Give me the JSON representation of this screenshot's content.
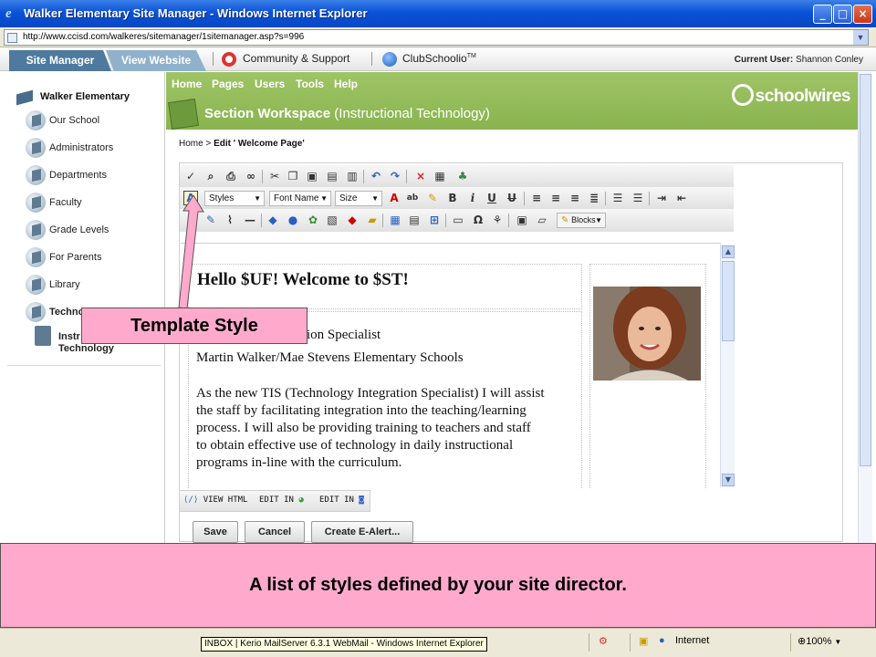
{
  "window": {
    "title": "Walker Elementary Site Manager - Windows Internet Explorer",
    "url": "http://www.ccisd.com/walkeres/sitemanager/1sitemanager.asp?s=996"
  },
  "header": {
    "tab_site_manager": "Site Manager",
    "tab_view_website": "View Website",
    "community_link": "Community & Support",
    "clubschoolio_link": "ClubSchoolio",
    "clubschoolio_tm": "TM",
    "current_user_label": "Current User:",
    "current_user_name": "Shannon Conley"
  },
  "sidebar": {
    "root": "Walker Elementary",
    "items": [
      {
        "label": "Our School"
      },
      {
        "label": "Administrators"
      },
      {
        "label": "Departments"
      },
      {
        "label": "Faculty"
      },
      {
        "label": "Grade Levels"
      },
      {
        "label": "For Parents"
      },
      {
        "label": "Library"
      },
      {
        "label": "Techno"
      }
    ],
    "subitem_line1": "Instr",
    "subitem_line2": "Technology"
  },
  "menu": {
    "items": [
      "Home",
      "Pages",
      "Users",
      "Tools",
      "Help"
    ],
    "workspace_title": "Section Workspace",
    "workspace_subtitle": "(Instructional Technology)",
    "logo": "schoolwires"
  },
  "breadcrumb": {
    "home": "Home",
    "sep": ">",
    "current": "Edit ' Welcome Page'"
  },
  "toolbar": {
    "styles": "Styles",
    "font_name": "Font Name",
    "size": "Size",
    "blocks": "Blocks",
    "bold": "B",
    "italic": "i",
    "underline": "U",
    "strike": "U",
    "omega": "Ω"
  },
  "content": {
    "heading": "Hello $UF! Welcome to $ST!",
    "line1": "Technology Integration Specialist",
    "line2": "Martin Walker/Mae Stevens Elementary Schools",
    "para1": "As the new TIS (Technology Integration Specialist) I will assist",
    "para2": "the staff by facilitating integration into the teaching/learning",
    "para3": "process. I will also be providing training to teachers and staff",
    "para4": "to obtain effective use of technology in daily instructional",
    "para5": "programs in-line with the curriculum."
  },
  "editor_tabs": {
    "view_html": "VIEW HTML",
    "edit_in_1": "EDIT IN",
    "edit_in_2": "EDIT IN"
  },
  "buttons": {
    "save": "Save",
    "cancel": "Cancel",
    "create_ealert": "Create E-Alert..."
  },
  "callout": {
    "label": "Template Style",
    "caption": "A list of styles defined by your site director."
  },
  "statusbar": {
    "tooltip": "INBOX | Kerio MailServer 6.3.1 WebMail - Windows Internet Explorer",
    "zone": "Internet",
    "zoom": "100%"
  },
  "colors": {
    "green_bar": "#8fb858",
    "callout_pink": "#ffaacc",
    "tab_active": "#4d7a9e",
    "tab_inactive": "#8fb1cc"
  }
}
